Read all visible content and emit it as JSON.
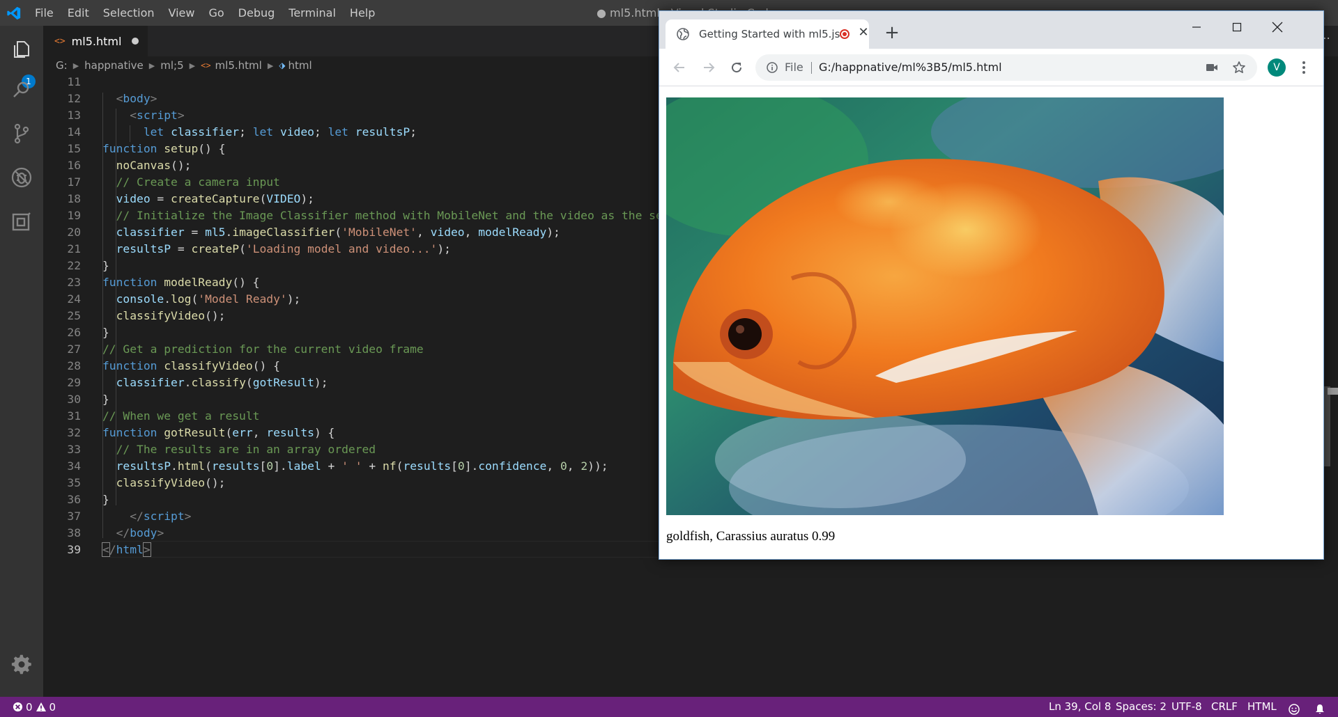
{
  "vscode": {
    "menu": [
      "File",
      "Edit",
      "Selection",
      "View",
      "Go",
      "Debug",
      "Terminal",
      "Help"
    ],
    "window_title": "● ml5.html - Visual Studio Code",
    "activity_badge": "1",
    "tab": {
      "label": "ml5.html",
      "icon": "<>"
    },
    "breadcrumb": [
      "G:",
      "happnative",
      "ml;5",
      "ml5.html",
      "html"
    ],
    "code_lines": [
      11,
      12,
      13,
      14,
      15,
      16,
      17,
      18,
      19,
      20,
      21,
      22,
      23,
      24,
      25,
      26,
      27,
      28,
      29,
      30,
      31,
      32,
      33,
      34,
      35,
      36,
      37,
      38,
      39
    ],
    "status": {
      "errors": "0",
      "warnings": "0",
      "position": "Ln 39, Col 8",
      "spaces": "Spaces: 2",
      "encoding": "UTF-8",
      "eol": "CRLF",
      "language": "HTML"
    },
    "colors": {
      "statusbar": "#68217a",
      "editor_bg": "#1e1e1e",
      "accent": "#007acc"
    }
  },
  "chrome": {
    "tab_title": "Getting Started with ml5.js",
    "omnibox": {
      "scheme_label": "File",
      "url": "G:/happnative/ml%3B5/ml5.html"
    },
    "avatar_letter": "V",
    "page": {
      "result": "goldfish, Carassius auratus 0.99"
    }
  },
  "icons": [
    "vscode-logo-icon",
    "explorer-icon",
    "search-icon",
    "source-control-icon",
    "debug-icon",
    "extensions-icon",
    "gear-icon",
    "globe-icon",
    "record-icon",
    "close-icon",
    "plus-icon",
    "minimize-icon",
    "maximize-icon",
    "back-icon",
    "forward-icon",
    "reload-icon",
    "info-icon",
    "camera-icon",
    "star-icon",
    "kebab-menu-icon",
    "error-icon",
    "warning-icon",
    "smiley-icon",
    "bell-icon"
  ]
}
